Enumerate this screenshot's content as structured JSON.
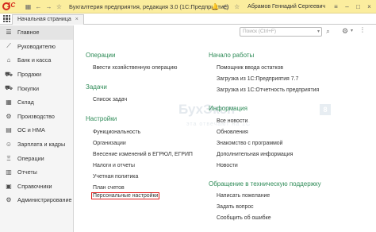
{
  "titlebar": {
    "logo_text": "1С",
    "title": "Бухгалтерия предприятия, редакция 3.0  (1С:Предприятие)",
    "user": "Абрамов Геннадий Сергеевич",
    "icons": [
      "grid-menu-icon",
      "back-arrow-icon",
      "forward-arrow-icon",
      "star-icon"
    ]
  },
  "tabs": {
    "home_label": "Начальная страница",
    "close_glyph": "×"
  },
  "sidebar": {
    "items": [
      {
        "label": "Главное",
        "icon": "menu-icon",
        "glyph": "☰"
      },
      {
        "label": "Руководителю",
        "icon": "chart-icon",
        "glyph": "📈"
      },
      {
        "label": "Банк и касса",
        "icon": "bank-icon",
        "glyph": "🏦"
      },
      {
        "label": "Продажи",
        "icon": "cart-out-icon",
        "glyph": "🛒"
      },
      {
        "label": "Покупки",
        "icon": "cart-in-icon",
        "glyph": "🛍"
      },
      {
        "label": "Склад",
        "icon": "warehouse-icon",
        "glyph": "▦"
      },
      {
        "label": "Производство",
        "icon": "production-icon",
        "glyph": "⚙"
      },
      {
        "label": "ОС и НМА",
        "icon": "assets-icon",
        "glyph": "▤"
      },
      {
        "label": "Зарплата и кадры",
        "icon": "staff-icon",
        "glyph": "👥"
      },
      {
        "label": "Операции",
        "icon": "operations-icon",
        "glyph": "Ξ"
      },
      {
        "label": "Отчеты",
        "icon": "reports-icon",
        "glyph": "▥"
      },
      {
        "label": "Справочники",
        "icon": "catalogs-icon",
        "glyph": "▣"
      },
      {
        "label": "Администрирование",
        "icon": "admin-icon",
        "glyph": "⚙"
      }
    ]
  },
  "search": {
    "placeholder": "Поиск (Ctrl+F)"
  },
  "main": {
    "left": {
      "operations_title": "Операции",
      "operations_links": [
        "Ввести хозяйственную операцию"
      ],
      "tasks_title": "Задачи",
      "tasks_links": [
        "Список задач"
      ],
      "settings_title": "Настройки",
      "settings_links": [
        "Функциональность",
        "Организации",
        "Внесение изменений в ЕГРЮЛ, ЕГРИП",
        "Налоги и отчеты",
        "Учетная политика",
        "План счетов",
        "Персональные настройки"
      ]
    },
    "right": {
      "start_title": "Начало работы",
      "start_links": [
        "Помощник ввода остатков",
        "Загрузка из 1С:Предприятия 7.7",
        "Загрузка из 1С:Отчетность предприятия"
      ],
      "info_title": "Информация",
      "info_links": [
        "Все новости",
        "Обновления",
        "Знакомство с программой",
        "Дополнительная информация",
        "Новости"
      ],
      "support_title": "Обращение в техническую поддержку",
      "support_links": [
        "Написать пожелание",
        "Задать вопрос",
        "Сообщить об ошибке"
      ]
    }
  },
  "watermark": {
    "text": "БухЭксп",
    "sub": "эта отвечают на 1С",
    "box": "8"
  },
  "colors": {
    "titlebar": "#fbed9e",
    "section_title": "#2e8b57",
    "highlight_border": "#e0201f"
  }
}
